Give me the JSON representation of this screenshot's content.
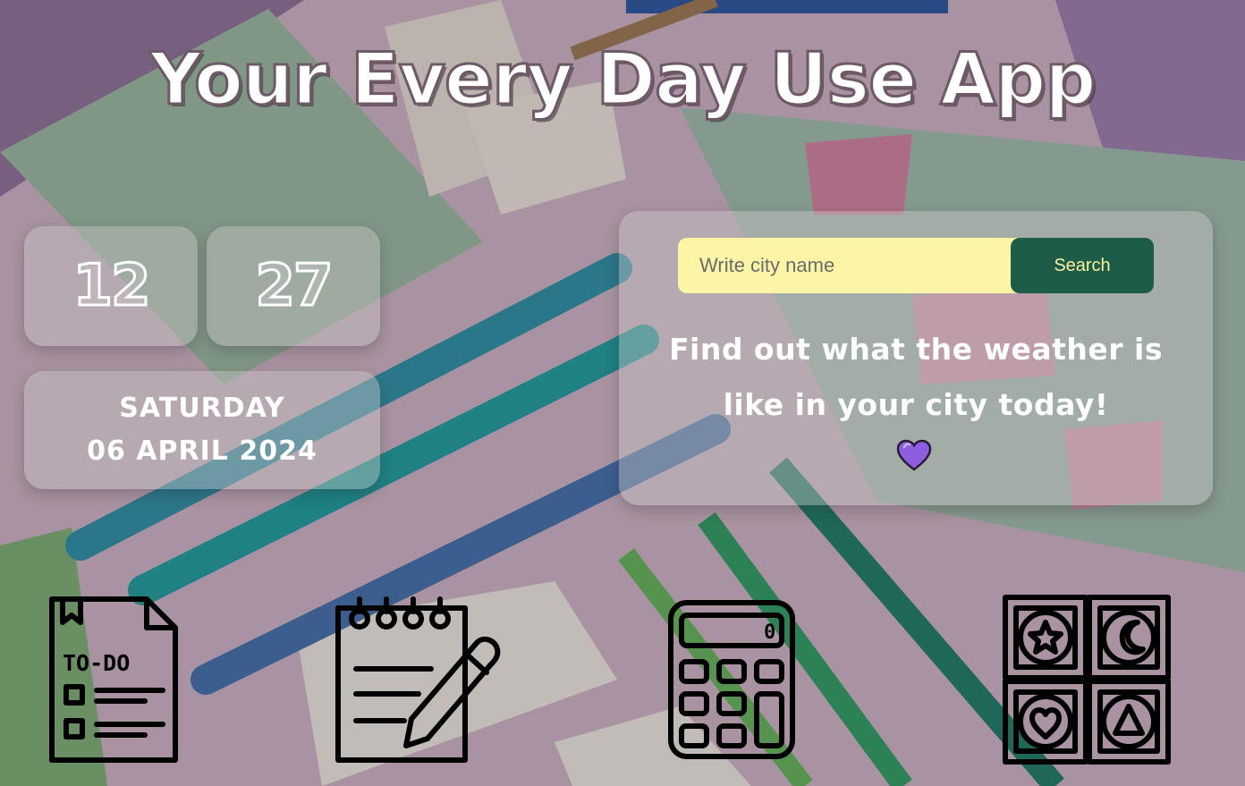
{
  "app": {
    "title": "Your Every Day Use App"
  },
  "clock": {
    "hours": "12",
    "minutes": "27"
  },
  "date": {
    "weekday": "SATURDAY",
    "full_date": "06 APRIL 2024"
  },
  "weather": {
    "input_placeholder": "Write city name",
    "input_value": "",
    "search_label": "Search",
    "message": "Find out what the weather is like in your city today!",
    "heart_icon": "purple-heart-icon"
  },
  "apps": [
    {
      "name": "todo",
      "icon": "todo-list-icon",
      "label": "TO-DO"
    },
    {
      "name": "notes",
      "icon": "notepad-pencil-icon"
    },
    {
      "name": "calculator",
      "icon": "calculator-icon",
      "display": "0"
    },
    {
      "name": "games",
      "icon": "game-shapes-icon"
    }
  ],
  "colors": {
    "search_button": "#1d5c46",
    "search_text": "#f6f0a0",
    "input_bg": "#fcf5a6",
    "heart": "#8d5fe0"
  }
}
